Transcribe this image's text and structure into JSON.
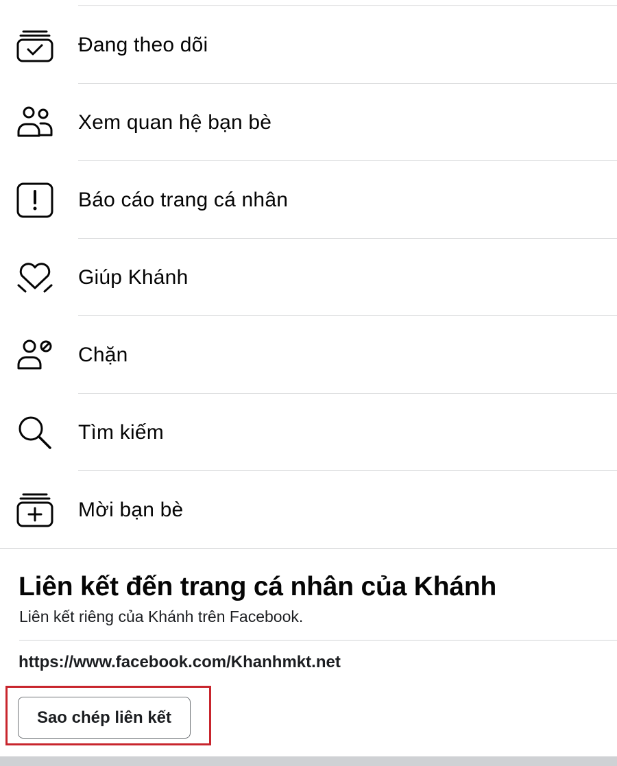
{
  "menu": {
    "items": [
      {
        "label": "Đang theo dõi",
        "icon": "following-check-icon"
      },
      {
        "label": "Xem quan hệ bạn bè",
        "icon": "friends-icon"
      },
      {
        "label": "Báo cáo trang cá nhân",
        "icon": "report-icon"
      },
      {
        "label": "Giúp Khánh",
        "icon": "heart-help-icon"
      },
      {
        "label": "Chặn",
        "icon": "block-user-icon"
      },
      {
        "label": "Tìm kiếm",
        "icon": "search-icon"
      },
      {
        "label": "Mời bạn bè",
        "icon": "invite-friends-icon"
      }
    ]
  },
  "profile_link": {
    "title": "Liên kết đến trang cá nhân của Khánh",
    "subtitle": "Liên kết riêng của Khánh trên Facebook.",
    "url": "https://www.facebook.com/Khanhmkt.net",
    "copy_button_label": "Sao chép liên kết"
  },
  "colors": {
    "highlight_border": "#c8252d",
    "divider": "#d2d3d5",
    "text": "#050505"
  }
}
